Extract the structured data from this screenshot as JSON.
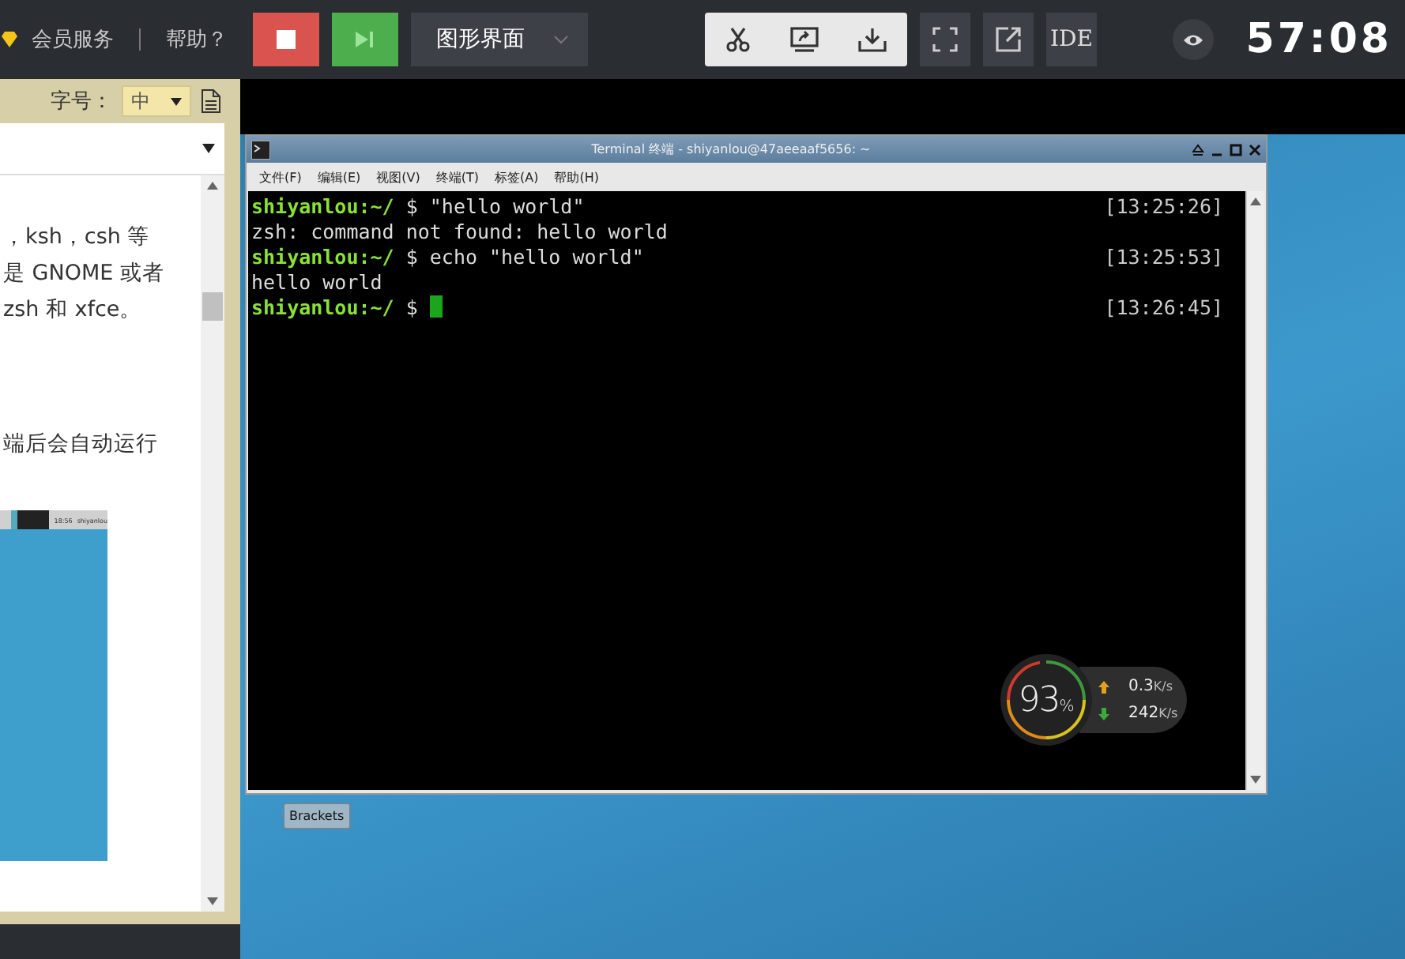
{
  "topbar": {
    "links": [
      {
        "label": "会员服务"
      },
      {
        "label": "帮助？"
      }
    ],
    "mode_select": {
      "value": "图形界面"
    },
    "ide_button": "IDE",
    "timer": "57:08"
  },
  "doc_panel": {
    "font_size_label": "字号：",
    "font_size_value": "中",
    "paragraphs": [
      "，ksh，csh 等",
      "是 GNOME 或者",
      "zsh 和 xfce。",
      "端后会自动运行"
    ],
    "thumbnail": {
      "time": "18:56",
      "user": "shiyanlou"
    }
  },
  "terminal": {
    "title": "Terminal 终端 - shiyanlou@47aeeaaf5656: ~",
    "menu": [
      "文件(F)",
      "编辑(E)",
      "视图(V)",
      "终端(T)",
      "标签(A)",
      "帮助(H)"
    ],
    "lines": [
      {
        "kind": "command",
        "prompt": "shiyanlou:~/",
        "symbol": "$",
        "text": "\"hello world\"",
        "time": "[13:25:26]"
      },
      {
        "kind": "output",
        "text": "zsh: command not found: hello world"
      },
      {
        "kind": "command",
        "prompt": "shiyanlou:~/",
        "symbol": "$",
        "text": "echo \"hello world\"",
        "time": "[13:25:53]"
      },
      {
        "kind": "output",
        "text": "hello world"
      },
      {
        "kind": "input",
        "prompt": "shiyanlou:~/",
        "symbol": "$",
        "time": "[13:26:45]"
      }
    ]
  },
  "monitor": {
    "percent": "93",
    "unit": "%",
    "upload": "0.3",
    "upload_unit": "K/s",
    "download": "242",
    "download_unit": "K/s"
  },
  "taskbar": [
    {
      "label": "Brackets"
    }
  ]
}
